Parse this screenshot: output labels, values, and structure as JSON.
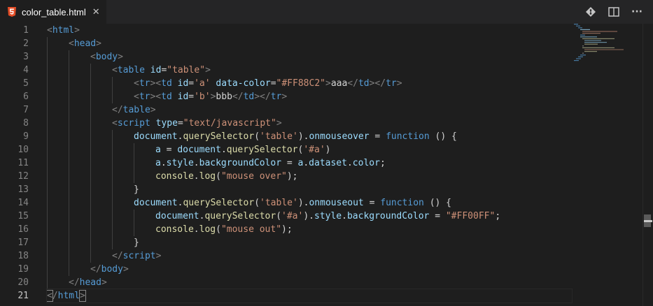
{
  "tab": {
    "file_name": "color_table.html",
    "close_glyph": "✕",
    "icon": "html5-icon"
  },
  "toolbar": {
    "icons": [
      "git-compare-icon",
      "split-editor-icon",
      "more-actions-icon"
    ],
    "more_glyph": "···"
  },
  "editor": {
    "active_line": 21,
    "line_numbers": [
      "1",
      "2",
      "3",
      "4",
      "5",
      "6",
      "7",
      "8",
      "9",
      "10",
      "11",
      "12",
      "13",
      "14",
      "15",
      "16",
      "17",
      "18",
      "19",
      "20",
      "21"
    ],
    "lines": {
      "l1": {
        "open": "<",
        "name": "html",
        "close": ">"
      },
      "l2": {
        "open": "<",
        "name": "head",
        "close": ">"
      },
      "l3": {
        "open": "<",
        "name": "body",
        "close": ">"
      },
      "l4": {
        "open": "<",
        "name": "table",
        "attr": "id",
        "eq": "=",
        "val": "\"table\"",
        "close": ">"
      },
      "l5": {
        "p1": "<",
        "t1": "tr",
        "p2": "><",
        "t2": "td",
        "attr1": "id",
        "eq1": "=",
        "val1": "'a'",
        "attr2": "data-color",
        "eq2": "=",
        "val2": "\"#FF88C2\"",
        "p3": ">",
        "text": "aaa",
        "p4": "</",
        "t3": "td",
        "p5": "></",
        "t4": "tr",
        "p6": ">"
      },
      "l6": {
        "p1": "<",
        "t1": "tr",
        "p2": "><",
        "t2": "td",
        "attr1": "id",
        "eq1": "=",
        "val1": "'b'",
        "p3": ">",
        "text": "bbb",
        "p4": "</",
        "t3": "td",
        "p5": "></",
        "t4": "tr",
        "p6": ">"
      },
      "l7": {
        "open": "</",
        "name": "table",
        "close": ">"
      },
      "l8": {
        "open": "<",
        "name": "script",
        "attr": "type",
        "eq": "=",
        "val": "\"text/javascript\"",
        "close": ">"
      },
      "l9": {
        "a": "document",
        "b": ".",
        "c": "querySelector",
        "d": "(",
        "e": "'table'",
        "f": ").",
        "g": "onmouseover",
        "h": " = ",
        "i": "function",
        "j": " () {"
      },
      "l10": {
        "a": "a",
        "b": " = ",
        "c": "document",
        "d": ".",
        "e": "querySelector",
        "f": "(",
        "g": "'#a'",
        "h": ")"
      },
      "l11": {
        "a": "a",
        "b": ".",
        "c": "style",
        "d": ".",
        "e": "backgroundColor",
        "f": " = ",
        "g": "a",
        "h": ".",
        "i": "dataset",
        "j": ".",
        "k": "color",
        "l": ";"
      },
      "l12": {
        "a": "console",
        "b": ".",
        "c": "log",
        "d": "(",
        "e": "\"mouse over\"",
        "f": ");"
      },
      "l13": {
        "a": "}"
      },
      "l14": {
        "a": "document",
        "b": ".",
        "c": "querySelector",
        "d": "(",
        "e": "'table'",
        "f": ").",
        "g": "onmouseout",
        "h": " = ",
        "i": "function",
        "j": " () {"
      },
      "l15": {
        "a": "document",
        "b": ".",
        "c": "querySelector",
        "d": "(",
        "e": "'#a'",
        "f": ").",
        "g": "style",
        "h": ".",
        "i": "backgroundColor",
        "j": " = ",
        "k": "\"#FF00FF\"",
        "l": ";"
      },
      "l16": {
        "a": "console",
        "b": ".",
        "c": "log",
        "d": "(",
        "e": "\"mouse out\"",
        "f": ");"
      },
      "l17": {
        "a": "}"
      },
      "l18": {
        "open": "</",
        "name": "script",
        "close": ">"
      },
      "l19": {
        "open": "</",
        "name": "body",
        "close": ">"
      },
      "l20": {
        "open": "</",
        "name": "head",
        "close": ">"
      },
      "l21": {
        "open": "<",
        "slash": "/",
        "name": "html",
        "close": ">"
      }
    }
  },
  "colors": {
    "background": "#1e1e1e",
    "tag": "#569cd6",
    "attribute": "#9cdcfe",
    "string": "#ce9178",
    "function": "#dcdcaa",
    "line_number": "#858585"
  }
}
